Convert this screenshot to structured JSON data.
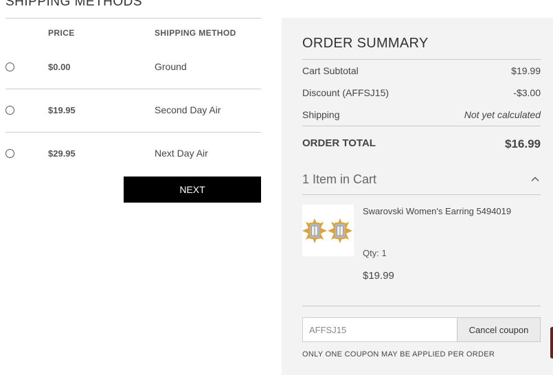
{
  "shipping": {
    "title": "SHIPPING METHODS",
    "price_header": "PRICE",
    "method_header": "SHIPPING METHOD",
    "options": [
      {
        "price": "$0.00",
        "method": "Ground"
      },
      {
        "price": "$19.95",
        "method": "Second Day Air"
      },
      {
        "price": "$29.95",
        "method": "Next Day Air"
      }
    ],
    "next_label": "NEXT"
  },
  "summary": {
    "title": "ORDER SUMMARY",
    "subtotal_label": "Cart Subtotal",
    "subtotal_value": "$19.99",
    "discount_label": "Discount (AFFSJ15)",
    "discount_value": "-$3.00",
    "shipping_label": "Shipping",
    "shipping_value": "Not yet calculated",
    "total_label": "ORDER TOTAL",
    "total_value": "$16.99",
    "items_count": "1 Item in Cart",
    "item": {
      "name": "Swarovski Women's Earring 5494019",
      "qty": "Qty: 1",
      "price": "$19.99"
    },
    "coupon_value": "AFFSJ15",
    "cancel_coupon_label": "Cancel coupon",
    "coupon_note": "ONLY ONE COUPON MAY BE APPLIED PER ORDER"
  },
  "icons": {
    "collapse": "chevron-up-icon",
    "radio": "radio-unselected"
  },
  "colors": {
    "primary_button": "#000000",
    "summary_background": "#f3f3f3",
    "chat_tab": "#7a1a1a"
  }
}
